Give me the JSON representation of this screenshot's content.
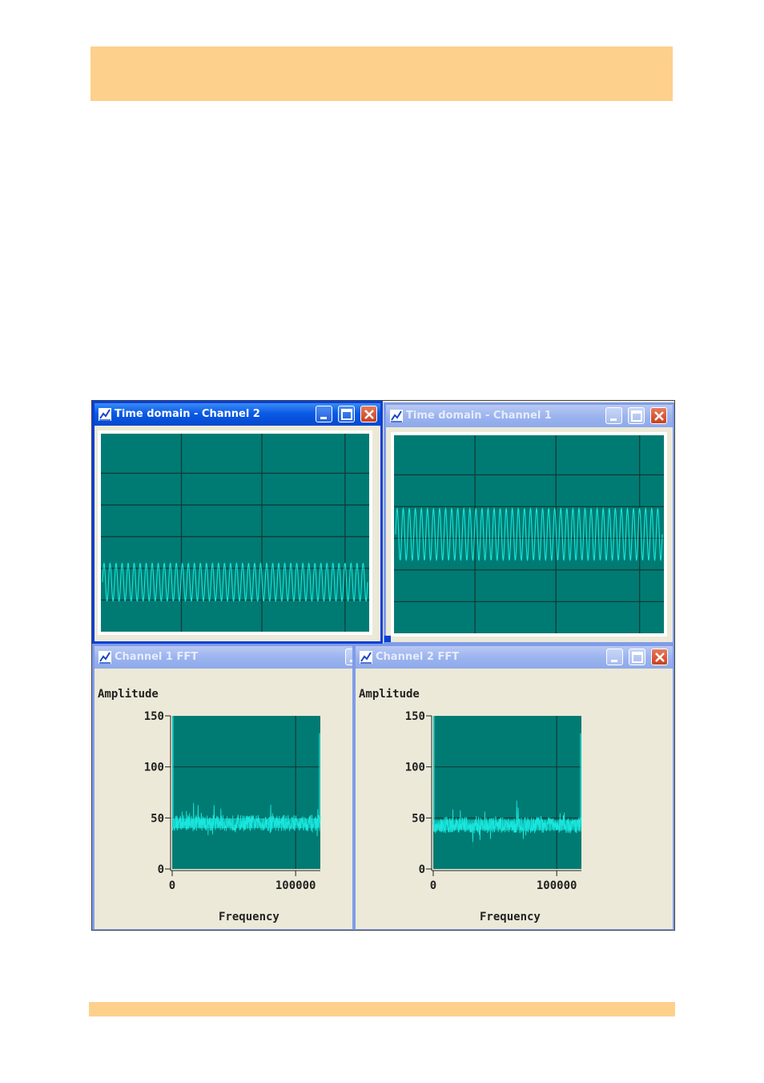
{
  "windows": {
    "time_ch2": {
      "title": "Time domain - Channel 2"
    },
    "time_ch1": {
      "title": "Time domain - Channel 1"
    },
    "fft_ch1": {
      "title": "Channel 1 FFT",
      "ylabel": "Amplitude",
      "xlabel": "Frequency"
    },
    "fft_ch2": {
      "title": "Channel 2 FFT",
      "ylabel": "Amplitude",
      "xlabel": "Frequency"
    }
  },
  "icons": [
    "graph-icon",
    "minimize-icon",
    "maximize-icon",
    "close-icon"
  ],
  "colors": {
    "band": "#fdd08c",
    "plot_bg": "#007b73",
    "grid": "#0f3c38",
    "trace": "#19e6dc",
    "active_title": "#0a5ae6",
    "inactive_title": "#9cb4ef",
    "window_bg": "#ece9d8"
  },
  "chart_data": [
    {
      "type": "line",
      "window": "Time domain - Channel 2",
      "description_series": "sine wave",
      "cycles": 44,
      "grid": true,
      "y_position_fraction": 0.75,
      "amplitude_fraction": 0.095
    },
    {
      "type": "line",
      "window": "Time domain - Channel 1",
      "description_series": "sine wave",
      "cycles": 44,
      "grid": true,
      "y_position_fraction": 0.5,
      "amplitude_fraction": 0.13
    },
    {
      "type": "area",
      "window": "Channel 1 FFT",
      "xlabel": "Frequency",
      "ylabel": "Amplitude",
      "xticks": [
        0,
        100000
      ],
      "yticks": [
        0,
        50,
        100,
        150
      ],
      "xlim": [
        0,
        120000
      ],
      "ylim": [
        0,
        150
      ],
      "noise_mean": 45,
      "noise_spread": 8,
      "peaks": [
        {
          "x": 0,
          "y": 150
        },
        {
          "x": 120000,
          "y": 133
        }
      ],
      "grid": true
    },
    {
      "type": "area",
      "window": "Channel 2 FFT",
      "xlabel": "Frequency",
      "ylabel": "Amplitude",
      "xticks": [
        0,
        100000
      ],
      "yticks": [
        0,
        50,
        100,
        150
      ],
      "xlim": [
        0,
        120000
      ],
      "ylim": [
        0,
        150
      ],
      "noise_mean": 43,
      "noise_spread": 8,
      "peaks": [
        {
          "x": 0,
          "y": 150
        },
        {
          "x": 120000,
          "y": 133
        }
      ],
      "grid": true
    }
  ]
}
